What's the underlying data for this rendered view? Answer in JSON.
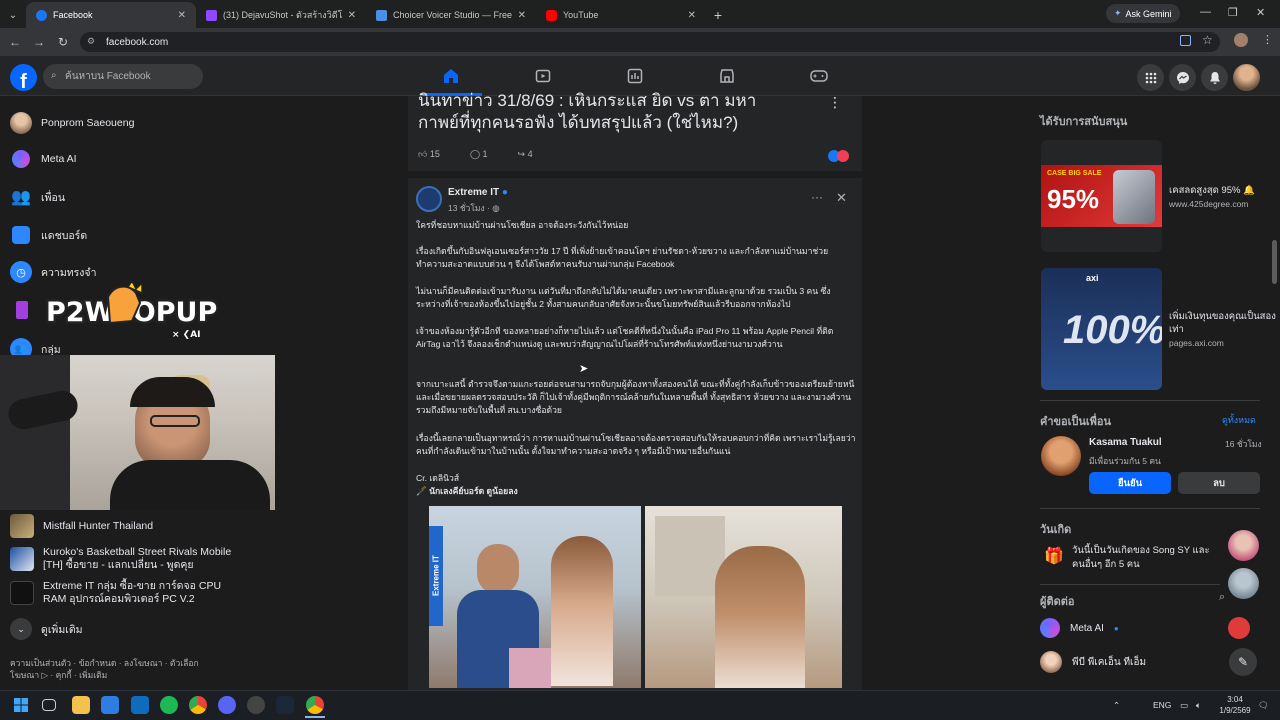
{
  "browser": {
    "tabs": [
      {
        "title": "Facebook",
        "color": "#1877f2",
        "active": true
      },
      {
        "title": "(31) DejavuShot - ตัวสร้างวิดีโอ -",
        "color": "#9146ff"
      },
      {
        "title": "Choicer Voicer Studio — Free C",
        "color": "#4a90e2"
      },
      {
        "title": "YouTube",
        "color": "#ff0000"
      }
    ],
    "ask_gemini": "Ask Gemini",
    "url": "facebook.com"
  },
  "fb": {
    "search_placeholder": "ค้นหาบน Facebook",
    "logo": "f"
  },
  "sidebar": {
    "items": [
      {
        "label": "Ponprom Saeoueng"
      },
      {
        "label": "Meta AI"
      },
      {
        "label": "เพื่อน"
      },
      {
        "label": "แดชบอร์ด"
      },
      {
        "label": "ความทรงจำ"
      },
      {
        "label": "กลุ่ม"
      }
    ],
    "groups": [
      {
        "label": "Mistfall Hunter Thailand"
      },
      {
        "label": "Kuroko's Basketball Street Rivals Mobile [TH] ซื้อขาย - แลกเปลี่ยน - พูดคุย"
      },
      {
        "label": "Extreme IT กลุ่ม ซื้อ-ขาย การ์ดจอ CPU RAM อุปกรณ์คอมพิวเตอร์ PC V.2"
      }
    ],
    "see_more": "ดูเพิ่มเติม",
    "footer": "ความเป็นส่วนตัว · ข้อกำหนด · ลงโฆษณา · ตัวเลือกโฆษณา ▷ · คุกกี้ · เพิ่มเติม"
  },
  "overlay": {
    "logo_main": "P2WTOPUP",
    "logo_sub": "× ❮AI"
  },
  "prev_post": {
    "title_line1": "นินทาข่าว 31/8/69 : เหินกระแส ยิด vs ตา มหา",
    "title_line2": "กาพย์ที่ทุกคนรอฟัง ได้บทสรุปแล้ว (ใช่ไหม?)",
    "likes": "15",
    "comments": "1",
    "shares": "4"
  },
  "post": {
    "author": "Extreme IT",
    "time": "13 ชั่วโมง ·",
    "p1": "ใครที่ชอบหาแม่บ้านผ่านโซเชียล อาจต้องระวังกันไว้หน่อย",
    "p2": "เรื่องเกิดขึ้นกับอินฟลูเอนเซอร์สาววัย 17 ปี ที่เพิ่งย้ายเข้าคอนโดฯ ย่านรัชดา-ห้วยขวาง และกำลังหาแม่บ้านมาช่วยทำความสะอาดแบบด่วน ๆ จึงได้โพสต์หาคนรับงานผ่านกลุ่ม Facebook",
    "p3": "ไม่นานก็มีคนติดต่อเข้ามารับงาน แต่วันที่มาถึงกลับไม่ได้มาคนเดียว เพราะพาสามีและลูกมาด้วย รวมเป็น 3 คน ซึ่งระหว่างที่เจ้าของห้องขึ้นไปอยู่ชั้น 2 ทั้งสามคนกลับอาศัยจังหวะนั้นขโมยทรัพย์สินแล้วรีบออกจากห้องไป",
    "p4": "เจ้าของห้องมารู้ตัวอีกที ของหลายอย่างก็หายไปแล้ว แต่โชคดีที่หนึ่งในนั้นคือ iPad Pro 11 พร้อม Apple Pencil ที่ติด AirTag เอาไว้ จึงลองเช็กตำแหน่งดู และพบว่าสัญญาณไปโผล่ที่ร้านโทรศัพท์แห่งหนึ่งย่านงามวงศ์วาน",
    "p5": "จากเบาะแสนี้ ตำรวจจึงตามแกะรอยต่อจนสามารถจับกุมผู้ต้องหาทั้งสองคนได้ ขณะที่ทั้งคู่กำลังเก็บข้าวของเตรียมย้ายหนี และเมื่อขยายผลตรวจสอบประวัติ ก็ไปเจ้าทั้งคู่มีพฤติการณ์คล้ายกันในหลายพื้นที่ ทั้งสุทธิสาร ห้วยขวาง และงามวงศ์วาน รวมถึงมีหมายจับในพื้นที่ สน.บางซื่อด้วย",
    "p6": "เรื่องนี้เลยกลายเป็นอุทาหรณ์ว่า การหาแม่บ้านผ่านโซเชียลอาจต้องตรวจสอบกันให้รอบคอบกว่าที่คิด เพราะเราไม่รู้เลยว่าคนที่กำลังเดินเข้ามาในบ้านนั้น ตั้งใจมาทำความสะอาดจริง ๆ หรือมีเป้าหมายอื่นกันแน่",
    "credit": "Cr. เดลินิวส์",
    "writer": "🖋️ นักเลงคีย์บอร์ด ดูน้อยลง",
    "image_tag": "Extreme IT"
  },
  "right": {
    "sponsored": "ได้รับการสนับสนุน",
    "ads": [
      {
        "title": "เคสลดสูงสุด 95% 🔔",
        "url": "www.425degree.com",
        "badge": "CASE BIG SALE",
        "big": "95%"
      },
      {
        "title": "เพิ่มเงินทุนของคุณเป็นสองเท่า",
        "url": "pages.axi.com",
        "badge": "axi",
        "big": "100%"
      }
    ],
    "friend_requests": "คำขอเป็นเพื่อน",
    "see_all": "ดูทั้งหมด",
    "request": {
      "name": "Kasama Tuakul",
      "time": "16 ชั่วโมง",
      "mutual": "มีเพื่อนร่วมกัน 5 คน",
      "confirm": "ยืนยัน",
      "delete": "ลบ"
    },
    "birthdays": "วันเกิด",
    "birthday_text": "วันนี้เป็นวันเกิดของ Song SY และคนอื่นๆ อีก 5 คน",
    "contacts": "ผู้ติดต่อ",
    "contact_list": [
      {
        "name": "Meta AI"
      },
      {
        "name": "พีบี พีเคเอ็น ทีเอ็ม"
      }
    ]
  },
  "taskbar": {
    "lang": "ENG",
    "time": "3:04",
    "date": "1/9/2569"
  },
  "colors": {
    "accent": "#0866ff",
    "bg": "#18191a",
    "card": "#242526"
  }
}
